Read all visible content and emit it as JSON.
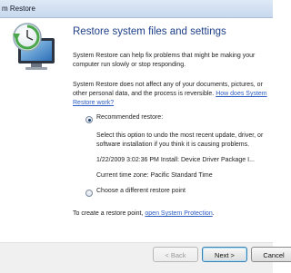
{
  "window": {
    "title": "m Restore"
  },
  "heading": "Restore system files and settings",
  "intro": "System Restore can help fix problems that might be making your computer run slowly or stop responding.",
  "note": {
    "text": "System Restore does not affect any of your documents, pictures, or other personal data, and the process is reversible. ",
    "link": "How does System Restore work?"
  },
  "options": {
    "recommended": {
      "label": "Recommended restore:",
      "selected": true,
      "description": "Select this option to undo the most recent update, driver, or software installation if you think it is causing problems.",
      "restore_point": "1/22/2009 3:02:36 PM Install: Device Driver Package I...",
      "timezone": "Current time zone: Pacific Standard Time"
    },
    "different": {
      "label": "Choose a different restore point",
      "selected": false
    }
  },
  "create_point": {
    "text": "To create a restore point, ",
    "link": "open System Protection",
    "suffix": "."
  },
  "buttons": {
    "back": "< Back",
    "next": "Next >",
    "cancel": "Cancel"
  },
  "icon": "system-restore-clock-icon"
}
